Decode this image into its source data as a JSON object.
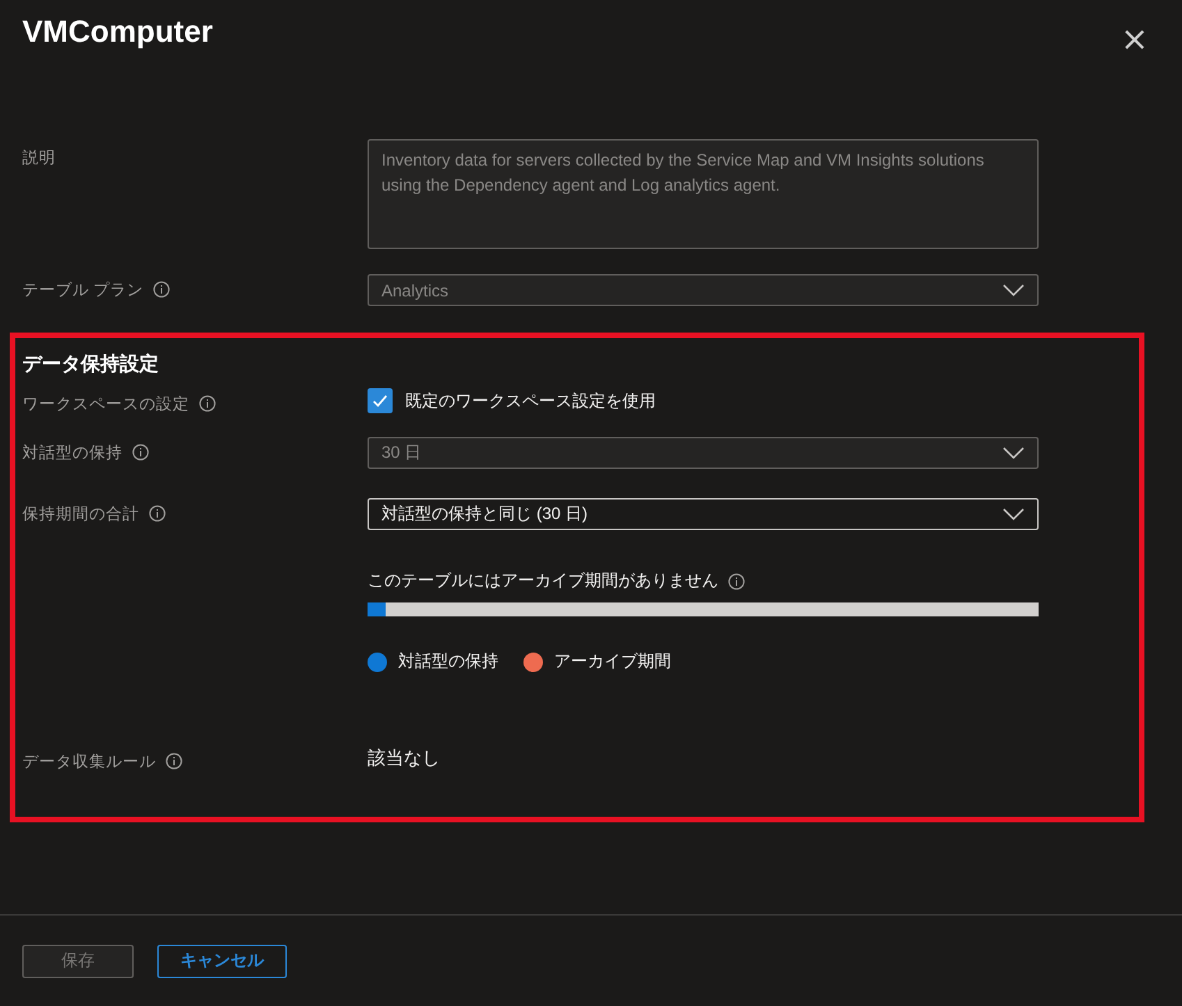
{
  "panel": {
    "title": "VMComputer",
    "close": "×"
  },
  "description": {
    "label": "説明",
    "value": "Inventory data for servers collected by the Service Map and VM Insights solutions using the Dependency agent and Log analytics agent."
  },
  "table_plan": {
    "label": "テーブル プラン",
    "info": true,
    "value": "Analytics",
    "disabled": true
  },
  "retention": {
    "heading": "データ保持設定",
    "workspace": {
      "label": "ワークスペースの設定",
      "info": true,
      "checkbox_label": "既定のワークスペース設定を使用",
      "checked": true
    },
    "interactive": {
      "label": "対話型の保持",
      "info": true,
      "value": "30 日",
      "disabled": true
    },
    "total": {
      "label": "保持期間の合計",
      "info": true,
      "value": "対話型の保持と同じ (30 日)",
      "disabled": false
    },
    "archive": {
      "message": "このテーブルにはアーカイブ期間がありません",
      "info": true,
      "level": 0.027,
      "legend": [
        {
          "label": "対話型の保持",
          "color": "#0f78d4"
        },
        {
          "label": "アーカイブ期間",
          "color": "#ee6b50"
        }
      ]
    },
    "collection_rules": {
      "label": "データ収集ルール",
      "info": true,
      "value": "該当なし"
    }
  },
  "buttons": [
    {
      "label": "保存",
      "kind": "secondary",
      "disabled": true
    },
    {
      "label": "キャンセル",
      "kind": "outline",
      "disabled": false
    }
  ]
}
